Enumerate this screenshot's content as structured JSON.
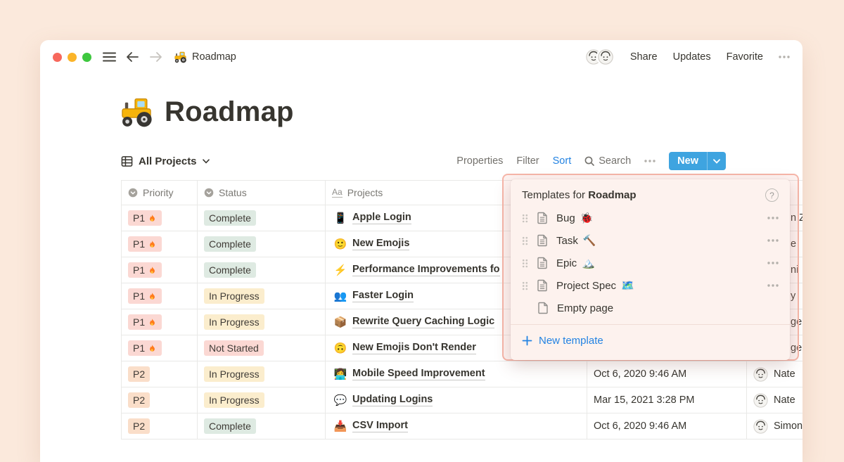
{
  "topbar": {
    "doc_emoji": "🚜",
    "doc_title": "Roadmap",
    "share": "Share",
    "updates": "Updates",
    "favorite": "Favorite"
  },
  "page": {
    "emoji": "🚜",
    "title": "Roadmap"
  },
  "view_bar": {
    "view_name": "All Projects",
    "properties": "Properties",
    "filter": "Filter",
    "sort": "Sort",
    "search": "Search",
    "new_button": "New"
  },
  "table": {
    "columns": [
      {
        "label": "Priority",
        "type": "select"
      },
      {
        "label": "Status",
        "type": "select"
      },
      {
        "label": "Projects",
        "type": "title",
        "icon_text": "Aa"
      }
    ],
    "rows": [
      {
        "priority": "P1",
        "priority_emoji": "🔥",
        "status": "Complete",
        "project_emoji": "📱",
        "project": "Apple Login"
      },
      {
        "priority": "P1",
        "priority_emoji": "🔥",
        "status": "Complete",
        "project_emoji": "🙂",
        "project": "New Emojis"
      },
      {
        "priority": "P1",
        "priority_emoji": "🔥",
        "status": "Complete",
        "project_emoji": "⚡",
        "project": "Performance Improvements fo"
      },
      {
        "priority": "P1",
        "priority_emoji": "🔥",
        "status": "In Progress",
        "project_emoji": "👥",
        "project": "Faster Login"
      },
      {
        "priority": "P1",
        "priority_emoji": "🔥",
        "status": "In Progress",
        "project_emoji": "📦",
        "project": "Rewrite Query Caching Logic"
      },
      {
        "priority": "P1",
        "priority_emoji": "🔥",
        "status": "Not Started",
        "project_emoji": "🙃",
        "project": "New Emojis Don't Render"
      },
      {
        "priority": "P2",
        "status": "In Progress",
        "project_emoji": "👩‍💻",
        "project": "Mobile Speed Improvement",
        "date": "Oct 6, 2020 9:46 AM",
        "person": "Nate"
      },
      {
        "priority": "P2",
        "status": "In Progress",
        "project_emoji": "💬",
        "project": "Updating Logins",
        "date": "Mar 15, 2021 3:28 PM",
        "person": "Nate"
      },
      {
        "priority": "P2",
        "status": "Complete",
        "project_emoji": "📥",
        "project": "CSV Import",
        "date": "Oct 6, 2020 9:46 AM",
        "person": "Simon"
      }
    ],
    "occluded_slivers": [
      {
        "text": "n Z"
      },
      {
        "text": "e"
      },
      {
        "text": "ni"
      },
      {
        "text": "y"
      },
      {
        "text": "ge"
      },
      {
        "text": "ge"
      }
    ]
  },
  "popup": {
    "title_prefix": "Templates for ",
    "title_name": "Roadmap",
    "items": [
      {
        "label": "Bug",
        "emoji": "🐞"
      },
      {
        "label": "Task",
        "emoji": "🔨"
      },
      {
        "label": "Epic",
        "emoji": "🏔️"
      },
      {
        "label": "Project Spec",
        "emoji": "🗺️"
      },
      {
        "label": "Empty page",
        "emoji": ""
      }
    ],
    "new_template": "New template"
  },
  "colors": {
    "page_bg": "#FBE9DC",
    "accent_blue": "#2383E2",
    "new_button_blue": "#3EA4E0",
    "tag_red_bg": "#FBD8D3",
    "tag_orange_bg": "#FADEC9",
    "tag_green_bg": "#DEEAE2",
    "tag_yellow_bg": "#FBEDCD",
    "popup_bg": "#FDF2EE",
    "popup_highlight_border": "#F6B6A9",
    "table_border": "#E9E9E7"
  }
}
